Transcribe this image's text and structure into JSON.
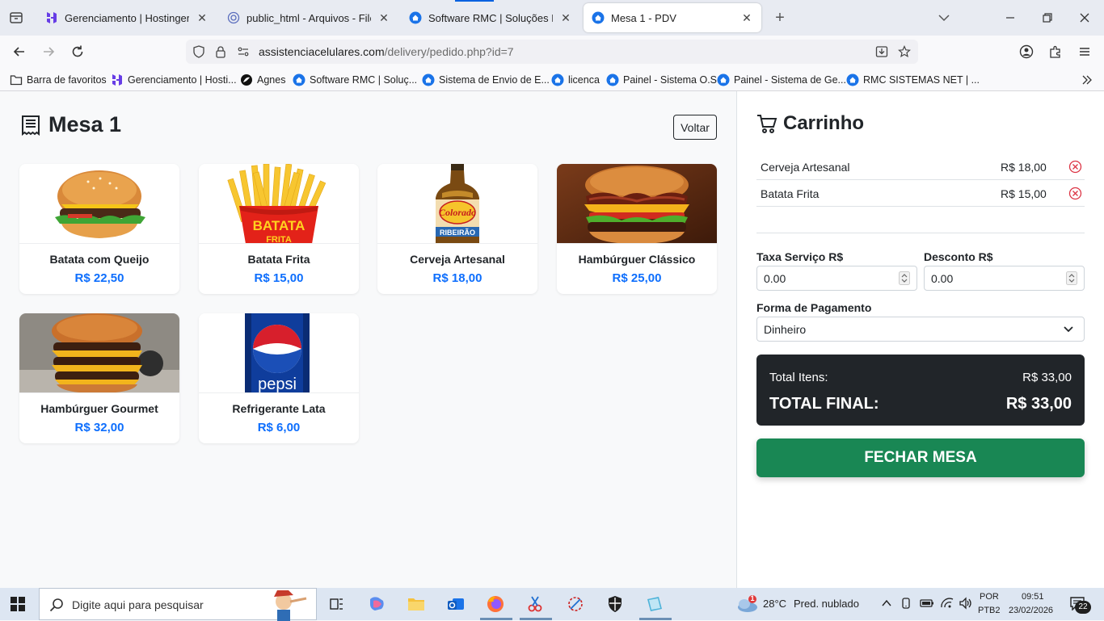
{
  "browser": {
    "tabs": [
      {
        "title": "Gerenciamento | Hostinger",
        "active": false
      },
      {
        "title": "public_html - Arquivos - File Bro",
        "active": false
      },
      {
        "title": "Software RMC | Soluções Digita",
        "active": false
      },
      {
        "title": "Mesa 1 - PDV",
        "active": true
      }
    ],
    "url_host": "assistenciacelulares.com",
    "url_path": "/delivery/pedido.php?id=7",
    "bookmarks": [
      "Barra de favoritos",
      "Gerenciamento | Hosti...",
      "Agnes",
      "Software RMC | Soluç...",
      "Sistema de Envio de E...",
      "licenca",
      "Painel - Sistema O.S",
      "Painel - Sistema de Ge...",
      "RMC SISTEMAS NET | ..."
    ]
  },
  "page": {
    "title": "Mesa 1",
    "back_label": "Voltar",
    "products": [
      {
        "name": "Batata com Queijo",
        "price": "R$ 22,50",
        "image": "cheeseburger"
      },
      {
        "name": "Batata Frita",
        "price": "R$ 15,00",
        "image": "fries"
      },
      {
        "name": "Cerveja Artesanal",
        "price": "R$ 18,00",
        "image": "beer-bottle"
      },
      {
        "name": "Hambúrguer Clássico",
        "price": "R$ 25,00",
        "image": "bacon-burger"
      },
      {
        "name": "Hambúrguer Gourmet",
        "price": "R$ 32,00",
        "image": "triple-burger"
      },
      {
        "name": "Refrigerante Lata",
        "price": "R$ 6,00",
        "image": "soda-can"
      }
    ],
    "fries_label": "BATATA",
    "fries_label2": "FRITA",
    "soda_label": "pepsi"
  },
  "cart": {
    "title": "Carrinho",
    "items": [
      {
        "name": "Cerveja Artesanal",
        "price": "R$ 18,00"
      },
      {
        "name": "Batata Frita",
        "price": "R$ 15,00"
      }
    ],
    "service_fee_label": "Taxa Serviço R$",
    "service_fee_value": "0.00",
    "discount_label": "Desconto R$",
    "discount_value": "0.00",
    "payment_label": "Forma de Pagamento",
    "payment_value": "Dinheiro",
    "total_items_label": "Total Itens:",
    "total_items_value": "R$ 33,00",
    "total_final_label": "TOTAL FINAL:",
    "total_final_value": "R$ 33,00",
    "close_button": "FECHAR MESA"
  },
  "taskbar": {
    "search_placeholder": "Digite aqui para pesquisar",
    "weather_temp": "28°C",
    "weather_desc": "Pred. nublado",
    "weather_badge": "1",
    "lang_1": "POR",
    "lang_2": "PTB2",
    "time": "09:51",
    "date": "23/02/2026",
    "notifications": "22"
  },
  "colors": {
    "accent": "#0d6efd",
    "success": "#198754",
    "dark": "#212529",
    "danger": "#dc3545"
  }
}
